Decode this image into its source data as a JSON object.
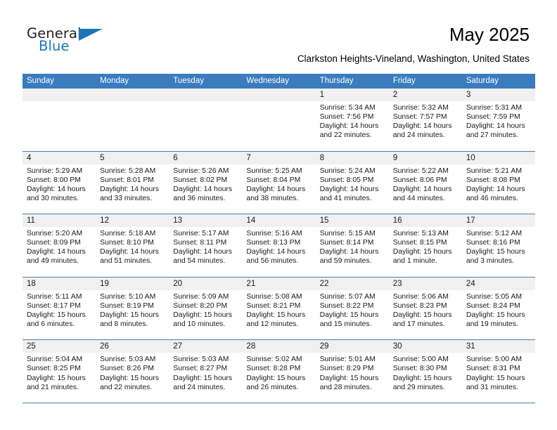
{
  "brand": {
    "name_part1": "General",
    "name_part2": "Blue"
  },
  "header": {
    "month_title": "May 2025",
    "location": "Clarkston Heights-Vineland, Washington, United States",
    "header_bg": "#3a7cbe",
    "accent": "#1b75bb"
  },
  "weekdays": [
    "Sunday",
    "Monday",
    "Tuesday",
    "Wednesday",
    "Thursday",
    "Friday",
    "Saturday"
  ],
  "weeks": [
    [
      {
        "day": "",
        "empty": true,
        "sunrise": "",
        "sunset": "",
        "daylight1": "",
        "daylight2": ""
      },
      {
        "day": "",
        "empty": true,
        "sunrise": "",
        "sunset": "",
        "daylight1": "",
        "daylight2": ""
      },
      {
        "day": "",
        "empty": true,
        "sunrise": "",
        "sunset": "",
        "daylight1": "",
        "daylight2": ""
      },
      {
        "day": "",
        "empty": true,
        "sunrise": "",
        "sunset": "",
        "daylight1": "",
        "daylight2": ""
      },
      {
        "day": "1",
        "empty": false,
        "sunrise": "Sunrise: 5:34 AM",
        "sunset": "Sunset: 7:56 PM",
        "daylight1": "Daylight: 14 hours",
        "daylight2": "and 22 minutes."
      },
      {
        "day": "2",
        "empty": false,
        "sunrise": "Sunrise: 5:32 AM",
        "sunset": "Sunset: 7:57 PM",
        "daylight1": "Daylight: 14 hours",
        "daylight2": "and 24 minutes."
      },
      {
        "day": "3",
        "empty": false,
        "sunrise": "Sunrise: 5:31 AM",
        "sunset": "Sunset: 7:59 PM",
        "daylight1": "Daylight: 14 hours",
        "daylight2": "and 27 minutes."
      }
    ],
    [
      {
        "day": "4",
        "empty": false,
        "sunrise": "Sunrise: 5:29 AM",
        "sunset": "Sunset: 8:00 PM",
        "daylight1": "Daylight: 14 hours",
        "daylight2": "and 30 minutes."
      },
      {
        "day": "5",
        "empty": false,
        "sunrise": "Sunrise: 5:28 AM",
        "sunset": "Sunset: 8:01 PM",
        "daylight1": "Daylight: 14 hours",
        "daylight2": "and 33 minutes."
      },
      {
        "day": "6",
        "empty": false,
        "sunrise": "Sunrise: 5:26 AM",
        "sunset": "Sunset: 8:02 PM",
        "daylight1": "Daylight: 14 hours",
        "daylight2": "and 36 minutes."
      },
      {
        "day": "7",
        "empty": false,
        "sunrise": "Sunrise: 5:25 AM",
        "sunset": "Sunset: 8:04 PM",
        "daylight1": "Daylight: 14 hours",
        "daylight2": "and 38 minutes."
      },
      {
        "day": "8",
        "empty": false,
        "sunrise": "Sunrise: 5:24 AM",
        "sunset": "Sunset: 8:05 PM",
        "daylight1": "Daylight: 14 hours",
        "daylight2": "and 41 minutes."
      },
      {
        "day": "9",
        "empty": false,
        "sunrise": "Sunrise: 5:22 AM",
        "sunset": "Sunset: 8:06 PM",
        "daylight1": "Daylight: 14 hours",
        "daylight2": "and 44 minutes."
      },
      {
        "day": "10",
        "empty": false,
        "sunrise": "Sunrise: 5:21 AM",
        "sunset": "Sunset: 8:08 PM",
        "daylight1": "Daylight: 14 hours",
        "daylight2": "and 46 minutes."
      }
    ],
    [
      {
        "day": "11",
        "empty": false,
        "sunrise": "Sunrise: 5:20 AM",
        "sunset": "Sunset: 8:09 PM",
        "daylight1": "Daylight: 14 hours",
        "daylight2": "and 49 minutes."
      },
      {
        "day": "12",
        "empty": false,
        "sunrise": "Sunrise: 5:18 AM",
        "sunset": "Sunset: 8:10 PM",
        "daylight1": "Daylight: 14 hours",
        "daylight2": "and 51 minutes."
      },
      {
        "day": "13",
        "empty": false,
        "sunrise": "Sunrise: 5:17 AM",
        "sunset": "Sunset: 8:11 PM",
        "daylight1": "Daylight: 14 hours",
        "daylight2": "and 54 minutes."
      },
      {
        "day": "14",
        "empty": false,
        "sunrise": "Sunrise: 5:16 AM",
        "sunset": "Sunset: 8:13 PM",
        "daylight1": "Daylight: 14 hours",
        "daylight2": "and 56 minutes."
      },
      {
        "day": "15",
        "empty": false,
        "sunrise": "Sunrise: 5:15 AM",
        "sunset": "Sunset: 8:14 PM",
        "daylight1": "Daylight: 14 hours",
        "daylight2": "and 59 minutes."
      },
      {
        "day": "16",
        "empty": false,
        "sunrise": "Sunrise: 5:13 AM",
        "sunset": "Sunset: 8:15 PM",
        "daylight1": "Daylight: 15 hours",
        "daylight2": "and 1 minute."
      },
      {
        "day": "17",
        "empty": false,
        "sunrise": "Sunrise: 5:12 AM",
        "sunset": "Sunset: 8:16 PM",
        "daylight1": "Daylight: 15 hours",
        "daylight2": "and 3 minutes."
      }
    ],
    [
      {
        "day": "18",
        "empty": false,
        "sunrise": "Sunrise: 5:11 AM",
        "sunset": "Sunset: 8:17 PM",
        "daylight1": "Daylight: 15 hours",
        "daylight2": "and 6 minutes."
      },
      {
        "day": "19",
        "empty": false,
        "sunrise": "Sunrise: 5:10 AM",
        "sunset": "Sunset: 8:19 PM",
        "daylight1": "Daylight: 15 hours",
        "daylight2": "and 8 minutes."
      },
      {
        "day": "20",
        "empty": false,
        "sunrise": "Sunrise: 5:09 AM",
        "sunset": "Sunset: 8:20 PM",
        "daylight1": "Daylight: 15 hours",
        "daylight2": "and 10 minutes."
      },
      {
        "day": "21",
        "empty": false,
        "sunrise": "Sunrise: 5:08 AM",
        "sunset": "Sunset: 8:21 PM",
        "daylight1": "Daylight: 15 hours",
        "daylight2": "and 12 minutes."
      },
      {
        "day": "22",
        "empty": false,
        "sunrise": "Sunrise: 5:07 AM",
        "sunset": "Sunset: 8:22 PM",
        "daylight1": "Daylight: 15 hours",
        "daylight2": "and 15 minutes."
      },
      {
        "day": "23",
        "empty": false,
        "sunrise": "Sunrise: 5:06 AM",
        "sunset": "Sunset: 8:23 PM",
        "daylight1": "Daylight: 15 hours",
        "daylight2": "and 17 minutes."
      },
      {
        "day": "24",
        "empty": false,
        "sunrise": "Sunrise: 5:05 AM",
        "sunset": "Sunset: 8:24 PM",
        "daylight1": "Daylight: 15 hours",
        "daylight2": "and 19 minutes."
      }
    ],
    [
      {
        "day": "25",
        "empty": false,
        "sunrise": "Sunrise: 5:04 AM",
        "sunset": "Sunset: 8:25 PM",
        "daylight1": "Daylight: 15 hours",
        "daylight2": "and 21 minutes."
      },
      {
        "day": "26",
        "empty": false,
        "sunrise": "Sunrise: 5:03 AM",
        "sunset": "Sunset: 8:26 PM",
        "daylight1": "Daylight: 15 hours",
        "daylight2": "and 22 minutes."
      },
      {
        "day": "27",
        "empty": false,
        "sunrise": "Sunrise: 5:03 AM",
        "sunset": "Sunset: 8:27 PM",
        "daylight1": "Daylight: 15 hours",
        "daylight2": "and 24 minutes."
      },
      {
        "day": "28",
        "empty": false,
        "sunrise": "Sunrise: 5:02 AM",
        "sunset": "Sunset: 8:28 PM",
        "daylight1": "Daylight: 15 hours",
        "daylight2": "and 26 minutes."
      },
      {
        "day": "29",
        "empty": false,
        "sunrise": "Sunrise: 5:01 AM",
        "sunset": "Sunset: 8:29 PM",
        "daylight1": "Daylight: 15 hours",
        "daylight2": "and 28 minutes."
      },
      {
        "day": "30",
        "empty": false,
        "sunrise": "Sunrise: 5:00 AM",
        "sunset": "Sunset: 8:30 PM",
        "daylight1": "Daylight: 15 hours",
        "daylight2": "and 29 minutes."
      },
      {
        "day": "31",
        "empty": false,
        "sunrise": "Sunrise: 5:00 AM",
        "sunset": "Sunset: 8:31 PM",
        "daylight1": "Daylight: 15 hours",
        "daylight2": "and 31 minutes."
      }
    ]
  ]
}
